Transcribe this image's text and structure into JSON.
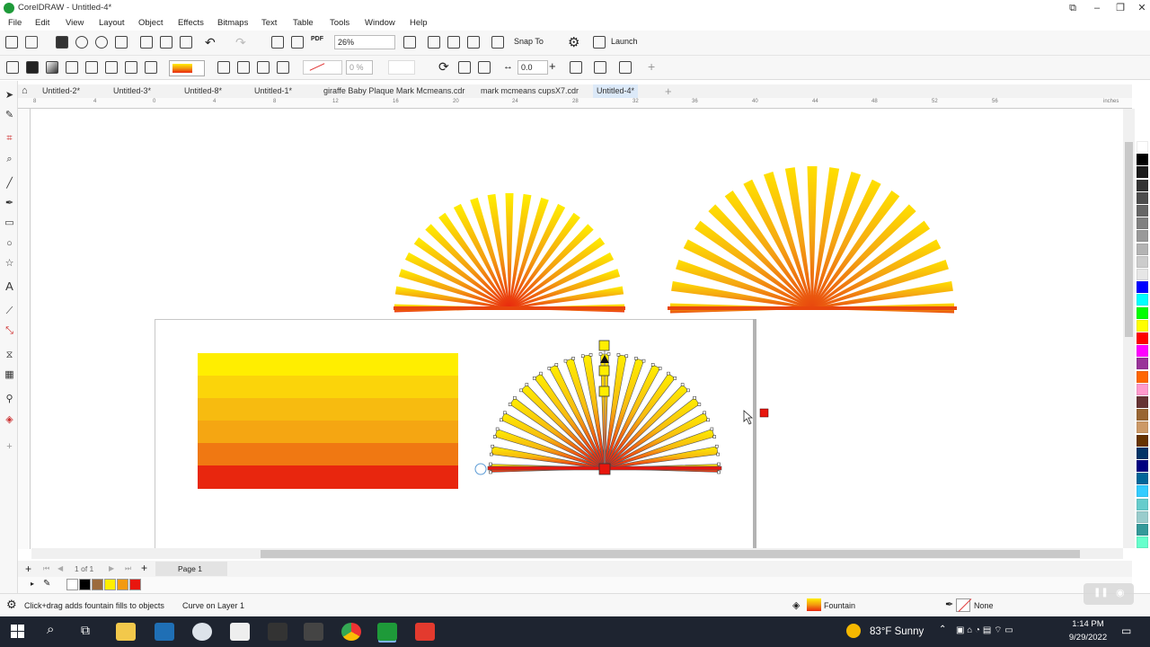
{
  "window": {
    "title": "CorelDRAW - Untitled-4*"
  },
  "menu": [
    "File",
    "Edit",
    "View",
    "Layout",
    "Object",
    "Effects",
    "Bitmaps",
    "Text",
    "Table",
    "Tools",
    "Window",
    "Help"
  ],
  "toolbar": {
    "zoom": "26%",
    "snap_to": "Snap To",
    "launch": "Launch",
    "pdf": "PDF"
  },
  "property_bar": {
    "transparency": "0 %",
    "outline_width": "0.0"
  },
  "tabs": [
    "Untitled-2*",
    "Untitled-3*",
    "Untitled-8*",
    "Untitled-1*",
    "giraffe Baby Plaque Mark Mcmeans.cdr",
    "mark mcmeans cupsX7.cdr",
    "Untitled-4*"
  ],
  "ruler": {
    "units": "inches",
    "h_ticks": [
      "8",
      "4",
      "0",
      "4",
      "8",
      "12",
      "16",
      "20",
      "24",
      "28",
      "32",
      "36",
      "40",
      "44",
      "48",
      "52",
      "56"
    ]
  },
  "pagebar": {
    "counter": "1 of 1",
    "page_tab": "Page 1"
  },
  "status": {
    "hint": "Click+drag adds fountain fills to objects",
    "object": "Curve on Layer 1",
    "fill_label": "Fountain",
    "outline_label": "None"
  },
  "taskbar": {
    "weather": "83°F  Sunny",
    "time": "1:14 PM",
    "date": "9/29/2022"
  },
  "colors": {
    "yellow": "#ffee00",
    "orange": "#f39a10",
    "red": "#e8260e",
    "accent": "#1e9a39"
  }
}
